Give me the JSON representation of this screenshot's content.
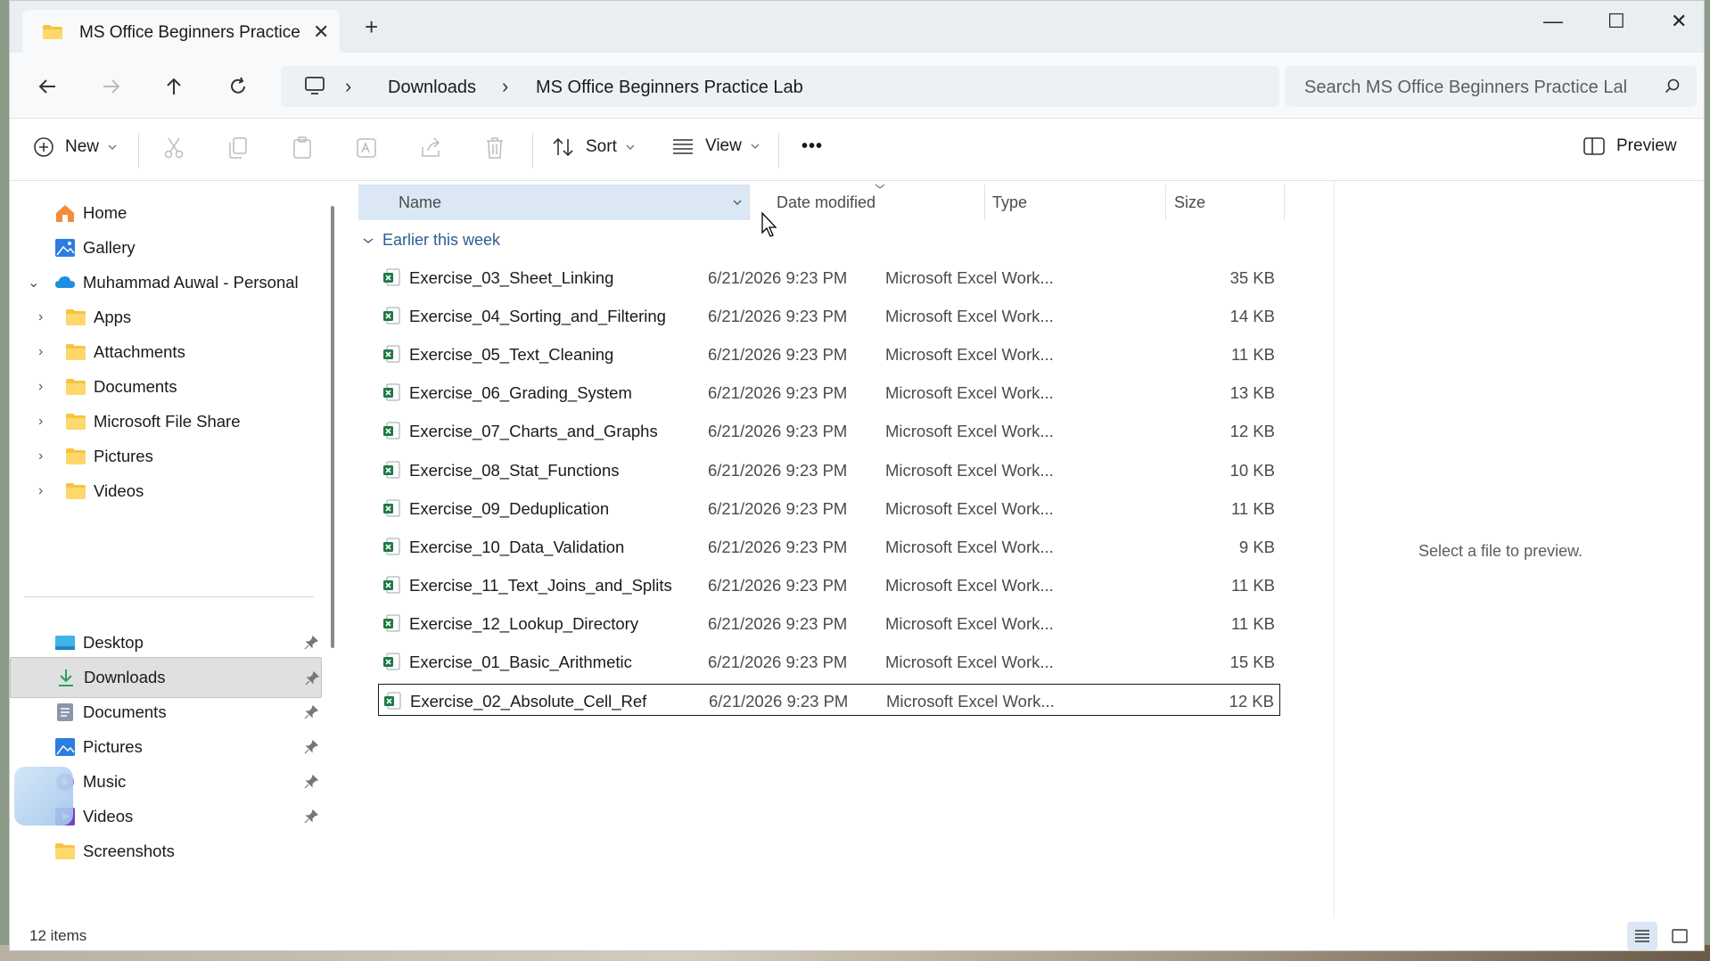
{
  "tab": {
    "title": "MS Office Beginners Practice",
    "close": "✕",
    "new_tab": "+"
  },
  "window_controls": {
    "minimize": "—",
    "maximize": "☐",
    "close": "✕"
  },
  "address": {
    "crumbs": [
      "Downloads",
      "MS Office Beginners Practice Lab"
    ],
    "sep": "›"
  },
  "search": {
    "placeholder": "Search MS Office Beginners Practice Lal"
  },
  "toolbar": {
    "new_label": "New",
    "sort_label": "Sort",
    "view_label": "View",
    "more_label": "•••",
    "preview_label": "Preview"
  },
  "sidebar": {
    "home": "Home",
    "gallery": "Gallery",
    "onedrive": "Muhammad Auwal - Personal",
    "folders": [
      "Apps",
      "Attachments",
      "Documents",
      "Microsoft File Share",
      "Pictures",
      "Videos"
    ],
    "quick": [
      {
        "label": "Desktop",
        "icon": "desktop-icon"
      },
      {
        "label": "Downloads",
        "icon": "download-icon"
      },
      {
        "label": "Documents",
        "icon": "documents-icon"
      },
      {
        "label": "Pictures",
        "icon": "pictures-icon"
      },
      {
        "label": "Music",
        "icon": "music-icon"
      },
      {
        "label": "Videos",
        "icon": "videos-icon"
      },
      {
        "label": "Screenshots",
        "icon": "folder-icon"
      }
    ]
  },
  "columns": {
    "name": "Name",
    "date": "Date modified",
    "type": "Type",
    "size": "Size"
  },
  "group": "Earlier this week",
  "files": [
    {
      "name": "Exercise_03_Sheet_Linking",
      "date": "6/21/2026 9:23 PM",
      "type": "Microsoft Excel Work...",
      "size": "35 KB"
    },
    {
      "name": "Exercise_04_Sorting_and_Filtering",
      "date": "6/21/2026 9:23 PM",
      "type": "Microsoft Excel Work...",
      "size": "14 KB"
    },
    {
      "name": "Exercise_05_Text_Cleaning",
      "date": "6/21/2026 9:23 PM",
      "type": "Microsoft Excel Work...",
      "size": "11 KB"
    },
    {
      "name": "Exercise_06_Grading_System",
      "date": "6/21/2026 9:23 PM",
      "type": "Microsoft Excel Work...",
      "size": "13 KB"
    },
    {
      "name": "Exercise_07_Charts_and_Graphs",
      "date": "6/21/2026 9:23 PM",
      "type": "Microsoft Excel Work...",
      "size": "12 KB"
    },
    {
      "name": "Exercise_08_Stat_Functions",
      "date": "6/21/2026 9:23 PM",
      "type": "Microsoft Excel Work...",
      "size": "10 KB"
    },
    {
      "name": "Exercise_09_Deduplication",
      "date": "6/21/2026 9:23 PM",
      "type": "Microsoft Excel Work...",
      "size": "11 KB"
    },
    {
      "name": "Exercise_10_Data_Validation",
      "date": "6/21/2026 9:23 PM",
      "type": "Microsoft Excel Work...",
      "size": "9 KB"
    },
    {
      "name": "Exercise_11_Text_Joins_and_Splits",
      "date": "6/21/2026 9:23 PM",
      "type": "Microsoft Excel Work...",
      "size": "11 KB"
    },
    {
      "name": "Exercise_12_Lookup_Directory",
      "date": "6/21/2026 9:23 PM",
      "type": "Microsoft Excel Work...",
      "size": "11 KB"
    },
    {
      "name": "Exercise_01_Basic_Arithmetic",
      "date": "6/21/2026 9:23 PM",
      "type": "Microsoft Excel Work...",
      "size": "15 KB"
    },
    {
      "name": "Exercise_02_Absolute_Cell_Ref",
      "date": "6/21/2026 9:23 PM",
      "type": "Microsoft Excel Work...",
      "size": "12 KB"
    }
  ],
  "preview_text": "Select a file to preview.",
  "status": {
    "count": "12 items"
  },
  "colors": {
    "accent": "#0067c0",
    "selected_header": "#dbe7f5",
    "excel_green": "#1d7a45",
    "folder_yellow": "#f6c342"
  }
}
